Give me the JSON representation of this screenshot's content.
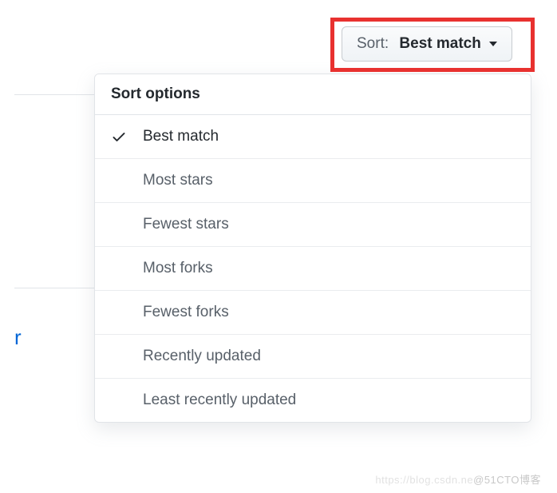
{
  "sort_button": {
    "prefix": "Sort:",
    "selected": "Best match"
  },
  "dropdown": {
    "title": "Sort options",
    "options": [
      {
        "label": "Best match",
        "selected": true
      },
      {
        "label": "Most stars",
        "selected": false
      },
      {
        "label": "Fewest stars",
        "selected": false
      },
      {
        "label": "Most forks",
        "selected": false
      },
      {
        "label": "Fewest forks",
        "selected": false
      },
      {
        "label": "Recently updated",
        "selected": false
      },
      {
        "label": "Least recently updated",
        "selected": false
      }
    ]
  },
  "partial_link_text": "r",
  "watermark": {
    "faint": "https://blog.csdn.ne",
    "main": "@51CTO博客"
  },
  "icons": {
    "check": "check-icon",
    "caret": "caret-down-icon"
  },
  "highlight_color": "#e8312f"
}
